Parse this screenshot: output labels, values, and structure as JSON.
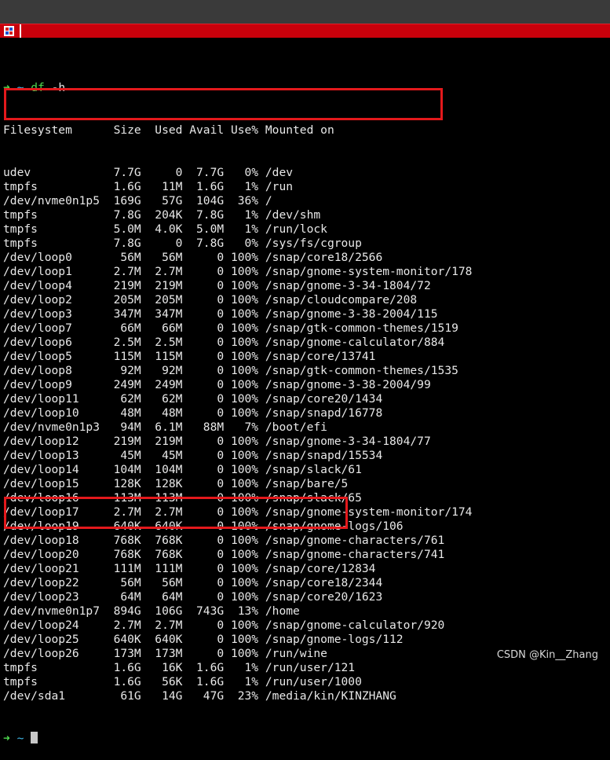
{
  "prompt": {
    "arrow": "➜",
    "dir": "~",
    "command": "df",
    "args": "-h"
  },
  "header": [
    "Filesystem",
    "Size",
    "Used",
    "Avail",
    "Use%",
    "Mounted on"
  ],
  "rows": [
    [
      "udev",
      "7.7G",
      "0",
      "7.7G",
      "0%",
      "/dev"
    ],
    [
      "tmpfs",
      "1.6G",
      "11M",
      "1.6G",
      "1%",
      "/run"
    ],
    [
      "/dev/nvme0n1p5",
      "169G",
      "57G",
      "104G",
      "36%",
      "/"
    ],
    [
      "tmpfs",
      "7.8G",
      "204K",
      "7.8G",
      "1%",
      "/dev/shm"
    ],
    [
      "tmpfs",
      "5.0M",
      "4.0K",
      "5.0M",
      "1%",
      "/run/lock"
    ],
    [
      "tmpfs",
      "7.8G",
      "0",
      "7.8G",
      "0%",
      "/sys/fs/cgroup"
    ],
    [
      "/dev/loop0",
      "56M",
      "56M",
      "0",
      "100%",
      "/snap/core18/2566"
    ],
    [
      "/dev/loop1",
      "2.7M",
      "2.7M",
      "0",
      "100%",
      "/snap/gnome-system-monitor/178"
    ],
    [
      "/dev/loop4",
      "219M",
      "219M",
      "0",
      "100%",
      "/snap/gnome-3-34-1804/72"
    ],
    [
      "/dev/loop2",
      "205M",
      "205M",
      "0",
      "100%",
      "/snap/cloudcompare/208"
    ],
    [
      "/dev/loop3",
      "347M",
      "347M",
      "0",
      "100%",
      "/snap/gnome-3-38-2004/115"
    ],
    [
      "/dev/loop7",
      "66M",
      "66M",
      "0",
      "100%",
      "/snap/gtk-common-themes/1519"
    ],
    [
      "/dev/loop6",
      "2.5M",
      "2.5M",
      "0",
      "100%",
      "/snap/gnome-calculator/884"
    ],
    [
      "/dev/loop5",
      "115M",
      "115M",
      "0",
      "100%",
      "/snap/core/13741"
    ],
    [
      "/dev/loop8",
      "92M",
      "92M",
      "0",
      "100%",
      "/snap/gtk-common-themes/1535"
    ],
    [
      "/dev/loop9",
      "249M",
      "249M",
      "0",
      "100%",
      "/snap/gnome-3-38-2004/99"
    ],
    [
      "/dev/loop11",
      "62M",
      "62M",
      "0",
      "100%",
      "/snap/core20/1434"
    ],
    [
      "/dev/loop10",
      "48M",
      "48M",
      "0",
      "100%",
      "/snap/snapd/16778"
    ],
    [
      "/dev/nvme0n1p3",
      "94M",
      "6.1M",
      "88M",
      "7%",
      "/boot/efi"
    ],
    [
      "/dev/loop12",
      "219M",
      "219M",
      "0",
      "100%",
      "/snap/gnome-3-34-1804/77"
    ],
    [
      "/dev/loop13",
      "45M",
      "45M",
      "0",
      "100%",
      "/snap/snapd/15534"
    ],
    [
      "/dev/loop14",
      "104M",
      "104M",
      "0",
      "100%",
      "/snap/slack/61"
    ],
    [
      "/dev/loop15",
      "128K",
      "128K",
      "0",
      "100%",
      "/snap/bare/5"
    ],
    [
      "/dev/loop16",
      "113M",
      "113M",
      "0",
      "100%",
      "/snap/slack/65"
    ],
    [
      "/dev/loop17",
      "2.7M",
      "2.7M",
      "0",
      "100%",
      "/snap/gnome-system-monitor/174"
    ],
    [
      "/dev/loop19",
      "640K",
      "640K",
      "0",
      "100%",
      "/snap/gnome-logs/106"
    ],
    [
      "/dev/loop18",
      "768K",
      "768K",
      "0",
      "100%",
      "/snap/gnome-characters/761"
    ],
    [
      "/dev/loop20",
      "768K",
      "768K",
      "0",
      "100%",
      "/snap/gnome-characters/741"
    ],
    [
      "/dev/loop21",
      "111M",
      "111M",
      "0",
      "100%",
      "/snap/core/12834"
    ],
    [
      "/dev/loop22",
      "56M",
      "56M",
      "0",
      "100%",
      "/snap/core18/2344"
    ],
    [
      "/dev/loop23",
      "64M",
      "64M",
      "0",
      "100%",
      "/snap/core20/1623"
    ],
    [
      "/dev/nvme0n1p7",
      "894G",
      "106G",
      "743G",
      "13%",
      "/home"
    ],
    [
      "/dev/loop24",
      "2.7M",
      "2.7M",
      "0",
      "100%",
      "/snap/gnome-calculator/920"
    ],
    [
      "/dev/loop25",
      "640K",
      "640K",
      "0",
      "100%",
      "/snap/gnome-logs/112"
    ],
    [
      "/dev/loop26",
      "173M",
      "173M",
      "0",
      "100%",
      "/run/wine"
    ],
    [
      "tmpfs",
      "1.6G",
      "16K",
      "1.6G",
      "1%",
      "/run/user/121"
    ],
    [
      "tmpfs",
      "1.6G",
      "56K",
      "1.6G",
      "1%",
      "/run/user/1000"
    ],
    [
      "/dev/sda1",
      "61G",
      "14G",
      "47G",
      "23%",
      "/media/kin/KINZHANG"
    ]
  ],
  "highlighted_rows": [
    "/dev/nvme0n1p5",
    "/dev/nvme0n1p7"
  ],
  "watermark": "CSDN @Kin__Zhang",
  "colors": {
    "tab_bar": "#c8000b",
    "highlight_box": "#e3191c",
    "prompt_arrow": "#4fd84f",
    "prompt_tilde": "#3fb8e8",
    "text": "#e8e8e8",
    "background": "#000000"
  }
}
